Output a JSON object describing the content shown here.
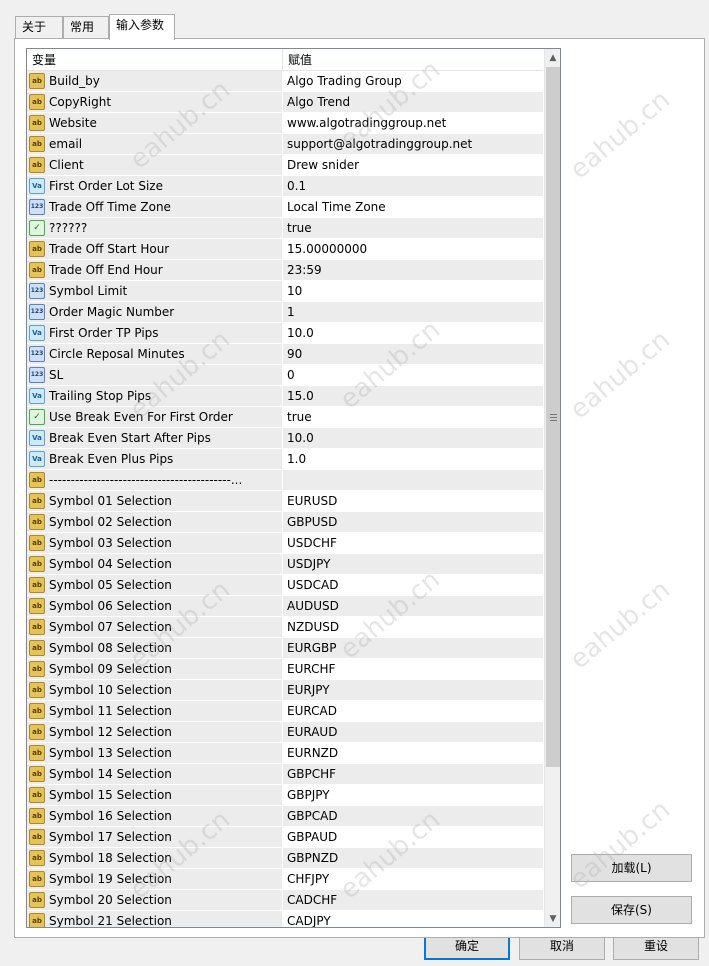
{
  "tabs": [
    {
      "label": "关于",
      "active": false
    },
    {
      "label": "常用",
      "active": false
    },
    {
      "label": "输入参数",
      "active": true
    }
  ],
  "grid": {
    "headers": {
      "name": "变量",
      "value": "赋值"
    },
    "rows": [
      {
        "icon": "ab",
        "name": "Build_by",
        "value": "Algo Trading Group"
      },
      {
        "icon": "ab",
        "name": "CopyRight",
        "value": "Algo Trend"
      },
      {
        "icon": "ab",
        "name": "Website",
        "value": "www.algotradinggroup.net"
      },
      {
        "icon": "ab",
        "name": "email",
        "value": "support@algotradinggroup.net"
      },
      {
        "icon": "ab",
        "name": "Client",
        "value": "Drew snider"
      },
      {
        "icon": "double",
        "name": "First Order Lot Size",
        "value": "0.1"
      },
      {
        "icon": "int",
        "name": "Trade Off Time Zone",
        "value": "Local Time Zone"
      },
      {
        "icon": "bool",
        "name": "??????",
        "value": "true"
      },
      {
        "icon": "ab",
        "name": "Trade Off Start Hour",
        "value": "15.00000000"
      },
      {
        "icon": "ab",
        "name": "Trade Off End Hour",
        "value": "23:59"
      },
      {
        "icon": "int",
        "name": "Symbol Limit",
        "value": "10"
      },
      {
        "icon": "int",
        "name": "Order Magic Number",
        "value": "1"
      },
      {
        "icon": "double",
        "name": "First Order TP Pips",
        "value": "10.0"
      },
      {
        "icon": "int",
        "name": "Circle Reposal Minutes",
        "value": "90"
      },
      {
        "icon": "int",
        "name": "SL",
        "value": "0"
      },
      {
        "icon": "double",
        "name": "Trailing Stop Pips",
        "value": "15.0"
      },
      {
        "icon": "bool",
        "name": "Use Break Even For First Order",
        "value": "true"
      },
      {
        "icon": "double",
        "name": "Break Even Start After Pips",
        "value": "10.0"
      },
      {
        "icon": "double",
        "name": "Break Even Plus Pips",
        "value": "1.0"
      },
      {
        "icon": "ab",
        "name": "------------------------------------------...",
        "value": ""
      },
      {
        "icon": "ab",
        "name": "Symbol 01 Selection",
        "value": "EURUSD"
      },
      {
        "icon": "ab",
        "name": "Symbol 02 Selection",
        "value": "GBPUSD"
      },
      {
        "icon": "ab",
        "name": "Symbol 03 Selection",
        "value": "USDCHF"
      },
      {
        "icon": "ab",
        "name": "Symbol 04 Selection",
        "value": "USDJPY"
      },
      {
        "icon": "ab",
        "name": "Symbol 05 Selection",
        "value": "USDCAD"
      },
      {
        "icon": "ab",
        "name": "Symbol 06 Selection",
        "value": "AUDUSD"
      },
      {
        "icon": "ab",
        "name": "Symbol 07 Selection",
        "value": "NZDUSD"
      },
      {
        "icon": "ab",
        "name": "Symbol 08 Selection",
        "value": "EURGBP"
      },
      {
        "icon": "ab",
        "name": "Symbol 09 Selection",
        "value": "EURCHF"
      },
      {
        "icon": "ab",
        "name": "Symbol 10 Selection",
        "value": "EURJPY"
      },
      {
        "icon": "ab",
        "name": "Symbol 11 Selection",
        "value": "EURCAD"
      },
      {
        "icon": "ab",
        "name": "Symbol 12 Selection",
        "value": "EURAUD"
      },
      {
        "icon": "ab",
        "name": "Symbol 13 Selection",
        "value": "EURNZD"
      },
      {
        "icon": "ab",
        "name": "Symbol 14 Selection",
        "value": "GBPCHF"
      },
      {
        "icon": "ab",
        "name": "Symbol 15 Selection",
        "value": "GBPJPY"
      },
      {
        "icon": "ab",
        "name": "Symbol 16 Selection",
        "value": "GBPCAD"
      },
      {
        "icon": "ab",
        "name": "Symbol 17 Selection",
        "value": "GBPAUD"
      },
      {
        "icon": "ab",
        "name": "Symbol 18 Selection",
        "value": "GBPNZD"
      },
      {
        "icon": "ab",
        "name": "Symbol 19 Selection",
        "value": "CHFJPY"
      },
      {
        "icon": "ab",
        "name": "Symbol 20 Selection",
        "value": "CADCHF"
      },
      {
        "icon": "ab",
        "name": "Symbol 21 Selection",
        "value": "CADJPY"
      }
    ]
  },
  "side_buttons": {
    "load": "加载(L)",
    "save": "保存(S)"
  },
  "footer_buttons": {
    "ok": "确定",
    "cancel": "取消",
    "reset": "重设"
  },
  "watermark": "eahub.cn",
  "icons": {
    "ab": "ab",
    "double": "Va",
    "int": "123",
    "bool": "✓"
  }
}
